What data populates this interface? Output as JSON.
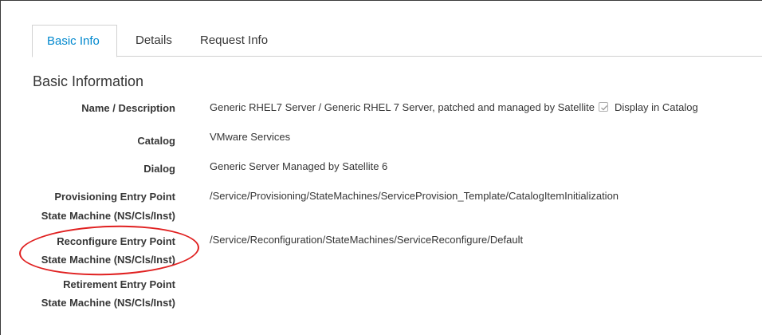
{
  "tabs": [
    {
      "label": "Basic Info",
      "active": true
    },
    {
      "label": "Details",
      "active": false
    },
    {
      "label": "Request Info",
      "active": false
    }
  ],
  "section_title": "Basic Information",
  "rows": {
    "name": {
      "label": "Name / Description",
      "value": "Generic RHEL7 Server / Generic RHEL 7 Server, patched and managed by Satellite",
      "display_in_catalog_label": "Display in Catalog",
      "display_in_catalog_checked": true
    },
    "catalog": {
      "label": "Catalog",
      "value": "VMware Services"
    },
    "dialog": {
      "label": "Dialog",
      "value": "Generic Server Managed by Satellite 6"
    },
    "provisioning": {
      "label_line1": "Provisioning Entry Point",
      "label_line2": "State Machine (NS/Cls/Inst)",
      "value": "/Service/Provisioning/StateMachines/ServiceProvision_Template/CatalogItemInitialization"
    },
    "reconfigure": {
      "label_line1": "Reconfigure Entry Point",
      "label_line2": "State Machine (NS/Cls/Inst)",
      "value": "/Service/Reconfiguration/StateMachines/ServiceReconfigure/Default"
    },
    "retirement": {
      "label_line1": "Retirement Entry Point",
      "label_line2": "State Machine (NS/Cls/Inst)",
      "value": ""
    }
  },
  "colors": {
    "active_tab": "#0088ce",
    "highlight": "#e02020"
  }
}
